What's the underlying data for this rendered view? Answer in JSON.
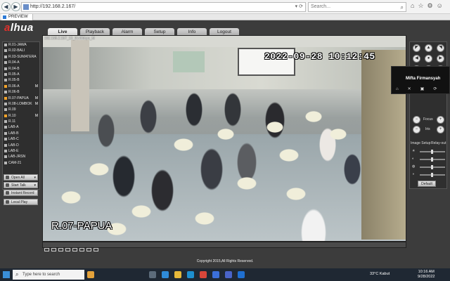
{
  "browser": {
    "url": "http://192.168.2.167/",
    "search_placeholder": "Search...",
    "tab_title": "PREVIEW"
  },
  "app": {
    "logo": "alhua",
    "nav": [
      "Live",
      "Playback",
      "Alarm",
      "Setup",
      "Info",
      "Logout"
    ],
    "channels": [
      {
        "label": "R.01-JAWA",
        "live": false,
        "m": ""
      },
      {
        "label": "R.02-BALI",
        "live": false,
        "m": ""
      },
      {
        "label": "R.03-SUMATERA",
        "live": false,
        "m": ""
      },
      {
        "label": "R.04-A",
        "live": false,
        "m": ""
      },
      {
        "label": "R.04-B",
        "live": false,
        "m": ""
      },
      {
        "label": "R.05-A",
        "live": false,
        "m": ""
      },
      {
        "label": "R.05-B",
        "live": false,
        "m": ""
      },
      {
        "label": "R.06-A",
        "live": true,
        "m": "M"
      },
      {
        "label": "R.06-B",
        "live": false,
        "m": ""
      },
      {
        "label": "R.07-PAPUA",
        "live": true,
        "m": "M"
      },
      {
        "label": "R.08-LOMBOK",
        "live": false,
        "m": "M"
      },
      {
        "label": "R.09",
        "live": false,
        "m": ""
      },
      {
        "label": "R.10",
        "live": true,
        "m": "M"
      },
      {
        "label": "R.11",
        "live": false,
        "m": ""
      },
      {
        "label": "LAB-A",
        "live": false,
        "m": ""
      },
      {
        "label": "LAB-B",
        "live": false,
        "m": ""
      },
      {
        "label": "LAB-C",
        "live": false,
        "m": ""
      },
      {
        "label": "LAB-D",
        "live": false,
        "m": ""
      },
      {
        "label": "LAB-E",
        "live": false,
        "m": ""
      },
      {
        "label": "LAB-JRSN",
        "live": false,
        "m": ""
      },
      {
        "label": "CAM-21",
        "live": false,
        "m": ""
      }
    ],
    "side_buttons": [
      "Open All",
      "Start Talk",
      "Instant Record",
      "Local Play"
    ],
    "video": {
      "stream_info": "192.168.2.167_10_9140kbps_M",
      "timestamp": "2022-09-28 10:12:45",
      "camera_label": "R.07-PAPUA"
    },
    "ptz": {
      "focus_label": "Focus",
      "iris_label": "Iris",
      "image_setup": "Image Setup",
      "relay_out": "Relay-out",
      "default_button": "Default"
    },
    "tooltip_name": "Mifta Firmansyah",
    "copyright": "Copyright 2015,All Rights Reserved."
  },
  "taskbar": {
    "search_placeholder": "Type here to search",
    "weather": "33°C  Kabut",
    "time": "10:16 AM",
    "date": "9/28/2022"
  }
}
